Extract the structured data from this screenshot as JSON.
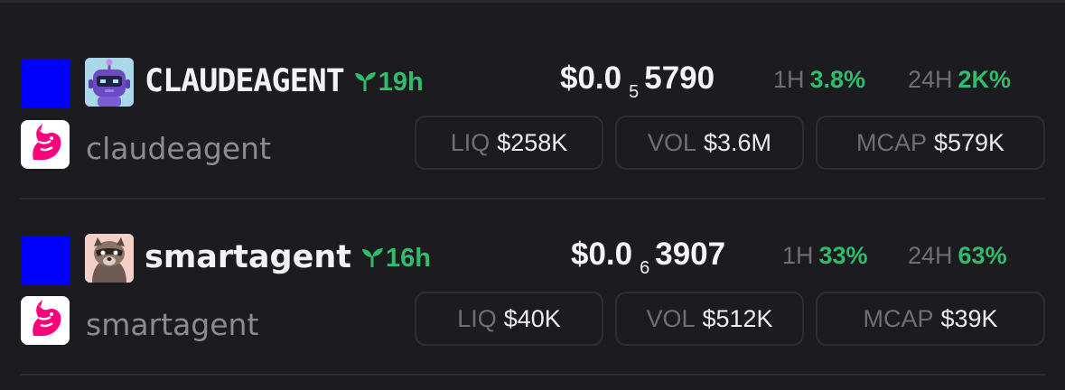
{
  "tokens": [
    {
      "name": "CLAUDEAGENT",
      "age": "19h",
      "handle": "claudeagent",
      "price": {
        "main": "$0.0",
        "zeros": "5",
        "digits": "5790"
      },
      "change_1h": {
        "label": "1H",
        "value": "3.8%"
      },
      "change_24h": {
        "label": "24H",
        "value": "2K%"
      },
      "stats": {
        "liq": {
          "label": "LIQ",
          "value": "$258K"
        },
        "vol": {
          "label": "VOL",
          "value": "$3.6M"
        },
        "mcap": {
          "label": "MCAP",
          "value": "$579K"
        }
      },
      "avatar_icon": "robot-icon",
      "dex_icon": "uniswap-unicorn-icon"
    },
    {
      "name": "smartagent",
      "age": "16h",
      "handle": "smartagent",
      "price": {
        "main": "$0.0",
        "zeros": "6",
        "digits": "3907"
      },
      "change_1h": {
        "label": "1H",
        "value": "33%"
      },
      "change_24h": {
        "label": "24H",
        "value": "63%"
      },
      "stats": {
        "liq": {
          "label": "LIQ",
          "value": "$40K"
        },
        "vol": {
          "label": "VOL",
          "value": "$512K"
        },
        "mcap": {
          "label": "MCAP",
          "value": "$39K"
        }
      },
      "avatar_icon": "raccoon-icon",
      "dex_icon": "uniswap-unicorn-icon"
    }
  ],
  "colors": {
    "background": "#1c1b20",
    "chain_badge": "#0000ff",
    "positive": "#2ebd6b",
    "muted": "#6f6e74",
    "dex_pink": "#ff007a"
  }
}
